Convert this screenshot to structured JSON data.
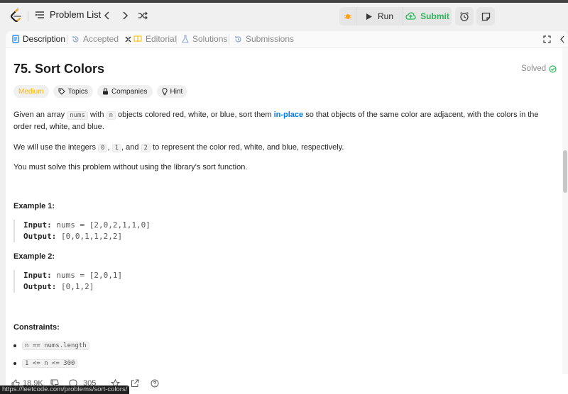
{
  "nav": {
    "problem_list_label": "Problem List",
    "run_label": "Run",
    "submit_label": "Submit"
  },
  "tabs": [
    {
      "label": "Description",
      "active": true
    },
    {
      "label": "Accepted",
      "active": false
    },
    {
      "label": "Editorial",
      "active": false
    },
    {
      "label": "Solutions",
      "active": false
    },
    {
      "label": "Submissions",
      "active": false
    }
  ],
  "problem": {
    "title": "75. Sort Colors",
    "status": "Solved",
    "difficulty": "Medium",
    "chips": [
      "Topics",
      "Companies",
      "Hint"
    ],
    "desc_1_part1": "Given an array ",
    "desc_1_code1": "nums",
    "desc_1_part2": " with ",
    "desc_1_code2": "n",
    "desc_1_part3": " objects colored red, white, or blue, sort them ",
    "desc_1_highlight": "in-place",
    "desc_1_part4": " so that objects of the same color are adjacent, with the colors in the order red, white, and blue.",
    "desc_2_part1": "We will use the integers ",
    "desc_2_code1": "0",
    "desc_2_part2": ", ",
    "desc_2_code2": "1",
    "desc_2_part3": ", and ",
    "desc_2_code3": "2",
    "desc_2_part4": " to represent the color red, white, and blue, respectively.",
    "desc_3": "You must solve this problem without using the library's sort function.",
    "example1_title": "Example 1:",
    "example1_input_label": "Input:",
    "example1_input": "nums = [2,0,2,1,1,0]",
    "example1_output_label": "Output:",
    "example1_output": "[0,0,1,1,2,2]",
    "example2_title": "Example 2:",
    "example2_input_label": "Input:",
    "example2_input": "nums = [2,0,1]",
    "example2_output_label": "Output:",
    "example2_output": "[0,1,2]",
    "constraints_title": "Constraints:",
    "constraints": [
      "n == nums.length",
      "1 <= n <= 300"
    ]
  },
  "footer": {
    "likes": "18.9K",
    "comments": "305"
  },
  "status_url": "https://leetcode.com/problems/sort-colors/",
  "colors": {
    "accent_blue": "#007aff",
    "submit_green": "#2db55d",
    "medium_yellow": "#ffb800",
    "solved_green": "#2db55d"
  }
}
